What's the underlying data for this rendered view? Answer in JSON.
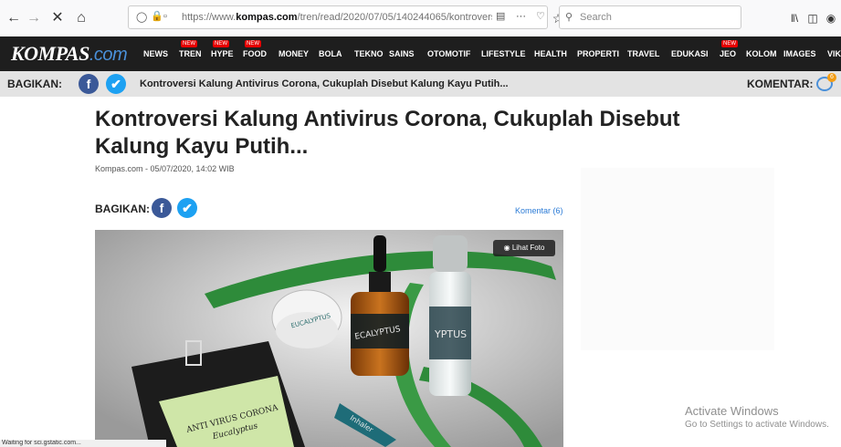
{
  "browser": {
    "url_prefix": "https://www.",
    "url_domain": "kompas.com",
    "url_path": "/tren/read/2020/07/05/140244065/kontroversi-kalu",
    "search_placeholder": "Search",
    "more_label": "···"
  },
  "nav": {
    "logo_main": "KOMPAS",
    "logo_suffix": ".com",
    "items": [
      {
        "label": "NEWS",
        "new": false
      },
      {
        "label": "TREN",
        "new": true
      },
      {
        "label": "HYPE",
        "new": true
      },
      {
        "label": "FOOD",
        "new": true
      },
      {
        "label": "MONEY",
        "new": false
      },
      {
        "label": "BOLA",
        "new": false
      },
      {
        "label": "TEKNO",
        "new": false
      },
      {
        "label": "SAINS",
        "new": false
      },
      {
        "label": "OTOMOTIF",
        "new": false
      },
      {
        "label": "LIFESTYLE",
        "new": false
      },
      {
        "label": "HEALTH",
        "new": false
      },
      {
        "label": "PROPERTI",
        "new": false
      },
      {
        "label": "TRAVEL",
        "new": false
      },
      {
        "label": "EDUKASI",
        "new": false
      },
      {
        "label": "JEO",
        "new": true
      },
      {
        "label": "KOLOM",
        "new": false
      },
      {
        "label": "IMAGES",
        "new": false
      },
      {
        "label": "VIK",
        "new": false
      }
    ],
    "new_badge": "NEW"
  },
  "sharebar": {
    "label": "BAGIKAN:",
    "title": "Kontroversi Kalung Antivirus Corona, Cukuplah Disebut Kalung Kayu Putih...",
    "komentar_label": "KOMENTAR:",
    "komentar_count": "6"
  },
  "article": {
    "headline": "Kontroversi Kalung Antivirus Corona, Cukuplah Disebut Kalung Kayu Putih...",
    "byline": "Kompas.com - 05/07/2020, 14:02 WIB",
    "share_label": "BAGIKAN:",
    "komentar_link": "Komentar (6)",
    "lihat_foto": "Lihat Foto",
    "photo_sachet_line1": "ANTI VIRUS CORONA",
    "photo_sachet_line2": "Eucalyptus",
    "photo_bottle_label": "ECALYPTUS",
    "photo_roller_label": "YPTUS",
    "photo_jar_label": "EUCALYPTUS",
    "photo_inhaler_label": "Inhaler"
  },
  "overlay": {
    "activate_title": "Activate Windows",
    "activate_sub": "Go to Settings to activate Windows."
  },
  "status": {
    "text": "Waiting for sci.gstatic.com..."
  },
  "colors": {
    "nav_bg": "#1e1e1e",
    "facebook": "#3b5998",
    "twitter": "#1da1f2",
    "link": "#2b7bd6",
    "new_badge": "#e60000"
  }
}
